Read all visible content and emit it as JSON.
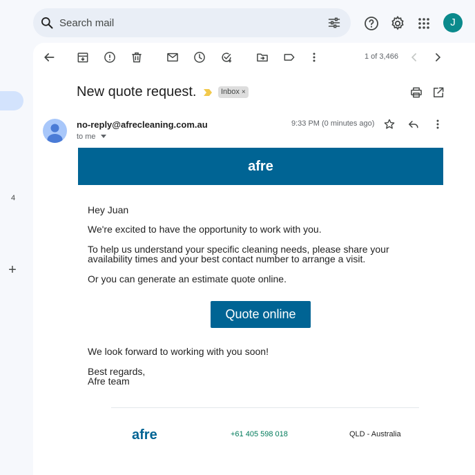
{
  "search": {
    "placeholder": "Search mail"
  },
  "user": {
    "initial": "J"
  },
  "rail": {
    "count": "4",
    "compose_symbol": "+"
  },
  "toolbar": {
    "pager": "1 of 3,466"
  },
  "email": {
    "subject": "New quote request.",
    "label": "Inbox",
    "label_close": "×",
    "sender": "no-reply@afrecleaning.com.au",
    "recipient": "to me",
    "time": "9:33 PM (0 minutes ago)"
  },
  "message": {
    "banner_logo": "afre",
    "greeting": "Hey Juan",
    "line1": "We're excited to have the opportunity to work with you.",
    "line2a": "To help us understand your specific cleaning needs, please share your",
    "line2b": "availability times and your best contact number to arrange a visit.",
    "line3": "Or you can generate an estimate quote online.",
    "button": "Quote online",
    "closing": "We look forward to working with you soon!",
    "regards": "Best regards,",
    "team": "Afre team"
  },
  "footer": {
    "logo": "afre",
    "phone": "+61 405 598 018",
    "location": "QLD - Australia"
  },
  "colors": {
    "brand": "#006494",
    "avatar": "#0b8a8c",
    "background": "#f6f8fc",
    "search_bg": "#e9eef6"
  }
}
